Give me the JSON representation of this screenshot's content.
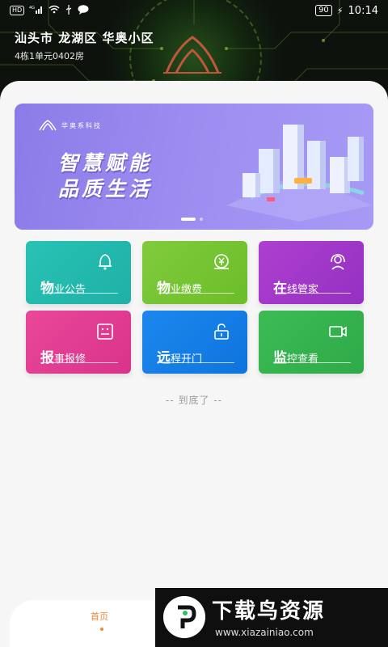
{
  "status_bar": {
    "hd": "HD",
    "signal": "4G",
    "battery": "90",
    "time": "10:14"
  },
  "header": {
    "location_title": "汕头市 龙湖区 华奥小区",
    "location_sub": "4栋1单元0402房"
  },
  "banner": {
    "brand": "华奥系科技",
    "line1": "智慧赋能",
    "line2": "品质生活",
    "active_slide": 1,
    "slide_count": 2
  },
  "tiles": [
    {
      "big": "物",
      "rest": "业公告",
      "icon": "bell-icon",
      "color": "#28c2b5"
    },
    {
      "big": "物",
      "rest": "业缴费",
      "icon": "payment-icon",
      "color": "#7fcb3c"
    },
    {
      "big": "在",
      "rest": "线管家",
      "icon": "headset-icon",
      "color": "#ae3fd0"
    },
    {
      "big": "报",
      "rest": "事报修",
      "icon": "repair-icon",
      "color": "#e9479a"
    },
    {
      "big": "远",
      "rest": "程开门",
      "icon": "unlock-icon",
      "color": "#1c88ee"
    },
    {
      "big": "监",
      "rest": "控查看",
      "icon": "camera-icon",
      "color": "#3cbb55"
    }
  ],
  "end_text": "-- 到底了 --",
  "nav": {
    "home_label": "首页"
  },
  "watermark": {
    "title": "下载鸟资源",
    "url": "www.xiazainiao.com"
  }
}
